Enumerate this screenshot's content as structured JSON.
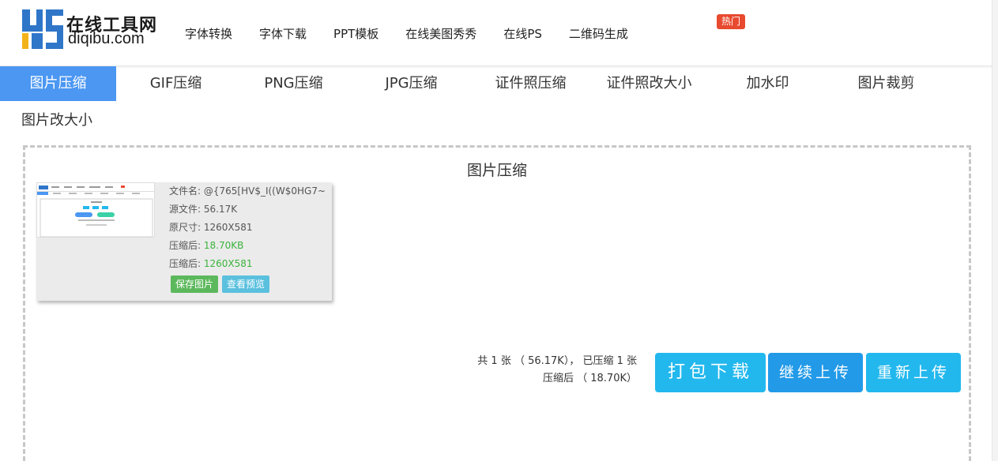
{
  "header": {
    "logo_title": "在线工具网",
    "logo_sub": "diqibu.com",
    "nav": [
      "字体转换",
      "字体下载",
      "PPT模板",
      "在线美图秀秀",
      "在线PS",
      "二维码生成"
    ],
    "hot_badge": "热门"
  },
  "tabs": {
    "items": [
      "图片压缩",
      "GIF压缩",
      "PNG压缩",
      "JPG压缩",
      "证件照压缩",
      "证件照改大小",
      "加水印",
      "图片裁剪"
    ],
    "active_index": 0,
    "second_row": "图片改大小"
  },
  "panel": {
    "title": "图片压缩",
    "card": {
      "filename_label": "文件名:",
      "filename": "@{765[HV$_I((W$0HG7~",
      "source_label": "源文件:",
      "source_size": "56.17K",
      "orig_dim_label": "原尺寸:",
      "orig_dim": "1260X581",
      "compressed_size_label": "压缩后:",
      "compressed_size": "18.70KB",
      "compressed_dim_label": "压缩后:",
      "compressed_dim": "1260X581",
      "save_button": "保存图片",
      "preview_button": "查看预览"
    },
    "summary_line1": "共 1 张 （ 56.17K），  已压缩 1 张",
    "summary_line2": "压缩后 （ 18.70K）",
    "download_button": "打包下载",
    "continue_button": "继续上传",
    "reupload_button": "重新上传"
  },
  "colors": {
    "active_tab": "#4b97f2",
    "hot": "#e84a2f",
    "green": "#3bb33b",
    "save_btn": "#5cb85c",
    "preview_btn": "#5bc0de",
    "download_btn": "#22b8ee",
    "continue_btn": "#229ae8"
  }
}
